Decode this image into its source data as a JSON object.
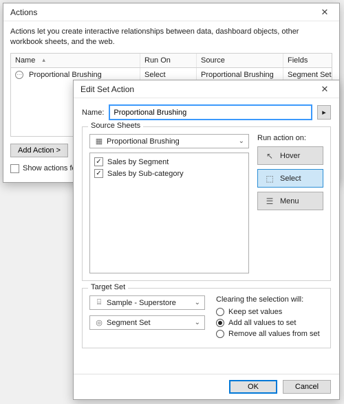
{
  "actions_window": {
    "title": "Actions",
    "intro": "Actions let you create interactive relationships between data, dashboard objects, other workbook sheets, and the web.",
    "columns": {
      "name": "Name",
      "run_on": "Run On",
      "source": "Source",
      "fields": "Fields"
    },
    "rows": [
      {
        "name": "Proportional Brushing",
        "run_on": "Select",
        "source": "Proportional Brushing",
        "fields": "Segment Set"
      }
    ],
    "add_action_label": "Add Action >",
    "show_actions_label": "Show actions for"
  },
  "edit_window": {
    "title": "Edit Set Action",
    "name_label": "Name:",
    "name_value": "Proportional Brushing",
    "source_sheets_title": "Source Sheets",
    "source_combo": "Proportional Brushing",
    "source_items": [
      {
        "label": "Sales by Segment",
        "checked": true
      },
      {
        "label": "Sales by Sub-category",
        "checked": true
      }
    ],
    "run_action_label": "Run action on:",
    "run_buttons": {
      "hover": "Hover",
      "select": "Select",
      "menu": "Menu"
    },
    "run_selected": "select",
    "target_set_title": "Target Set",
    "target_combo1": "Sample - Superstore",
    "target_combo2": "Segment Set",
    "clearing_label": "Clearing the selection will:",
    "clearing_options": {
      "keep": "Keep set values",
      "add": "Add all values to set",
      "remove": "Remove all values from set"
    },
    "clearing_selected": "add",
    "ok_label": "OK",
    "cancel_label": "Cancel"
  }
}
